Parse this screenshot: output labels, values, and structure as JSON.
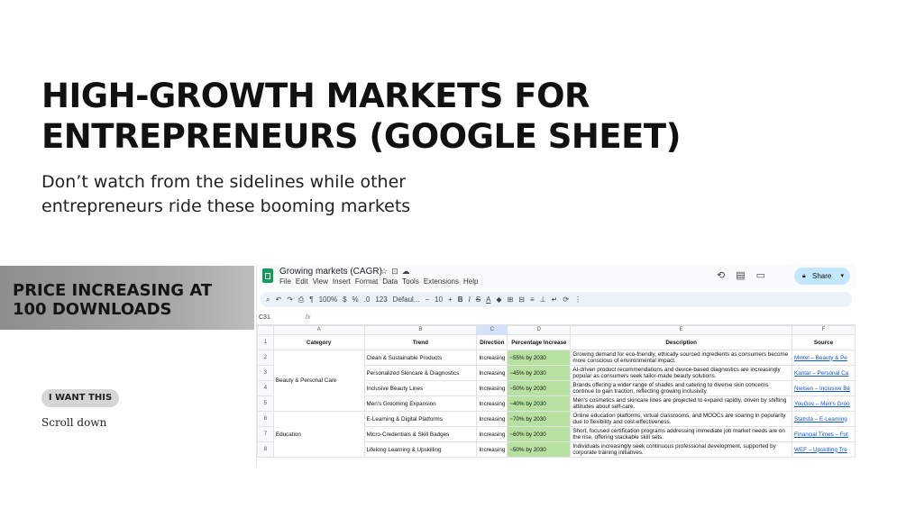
{
  "headline": [
    "HIGH-GROWTH MARKETS FOR",
    "ENTREPRENEURS (GOOGLE SHEET)"
  ],
  "subhead": [
    "Don’t watch from the sidelines while other",
    "entrepreneurs ride these booming markets"
  ],
  "banner": [
    "PRICE INCREASING AT",
    "100 DOWNLOADS"
  ],
  "cta_label": "I WANT THIS",
  "scroll_label": "Scroll down",
  "sheet": {
    "title": "Growing markets (CAGR)",
    "menu": [
      "File",
      "Edit",
      "View",
      "Insert",
      "Format",
      "Data",
      "Tools",
      "Extensions",
      "Help"
    ],
    "share_label": "Share",
    "toolbar": {
      "zoom": "100%",
      "format_123": "123",
      "font": "Defaul...",
      "font_size": "10"
    },
    "name_box": "C31",
    "fx": "fx",
    "col_letters": [
      "A",
      "B",
      "C",
      "D",
      "E",
      "F"
    ],
    "headers": [
      "Category",
      "Trend",
      "Direction",
      "Percentage Increase",
      "Description",
      "Source"
    ],
    "rows": [
      {
        "num": "2",
        "trend": "Clean & Sustainable Products",
        "dir": "Increasing",
        "pct": "~55% by 2030",
        "desc": "Growing demand for eco-friendly, ethically sourced ingredients as consumers become more conscious of environmental impact.",
        "src": "Mintel – Beauty & Pe"
      },
      {
        "num": "3",
        "trend": "Personalized Skincare & Diagnostics",
        "dir": "Increasing",
        "pct": "~45% by 2030",
        "desc": "AI-driven product recommendations and device-based diagnostics are increasingly popular as consumers seek tailor-made beauty solutions.",
        "src": "Kantar – Personal Ca"
      },
      {
        "num": "4",
        "trend": "Inclusive Beauty Lines",
        "dir": "Increasing",
        "pct": "~50% by 2030",
        "desc": "Brands offering a wider range of shades and catering to diverse skin concerns continue to gain traction, reflecting growing inclusivity.",
        "src": "Nielsen – Inclusive Be"
      },
      {
        "num": "5",
        "trend": "Men's Grooming Expansion",
        "dir": "Increasing",
        "pct": "~40% by 2030",
        "desc": "Men's cosmetics and skincare lines are projected to expand rapidly, driven by shifting attitudes about self-care.",
        "src": "YouGov – Men's Groo"
      },
      {
        "num": "6",
        "trend": "E-Learning & Digital Platforms",
        "dir": "Increasing",
        "pct": "~70% by 2030",
        "desc": "Online education platforms, virtual classrooms, and MOOCs are soaring in popularity due to flexibility and cost-effectiveness.",
        "src": "Statista – E-Learning"
      },
      {
        "num": "7",
        "trend": "Micro-Credentials & Skill Badges",
        "dir": "Increasing",
        "pct": "~60% by 2030",
        "desc": "Short, focused certification programs addressing immediate job market needs are on the rise, offering stackable skill sets.",
        "src": "Financial Times – Fut"
      },
      {
        "num": "8",
        "trend": "Lifelong Learning & Upskilling",
        "dir": "Increasing",
        "pct": "~50% by 2030",
        "desc": "Individuals increasingly seek continuous professional development, supported by corporate training initiatives.",
        "src": "WEF – Upskilling Tre"
      }
    ],
    "categories": [
      "Beauty & Personal Care",
      "Education"
    ]
  }
}
